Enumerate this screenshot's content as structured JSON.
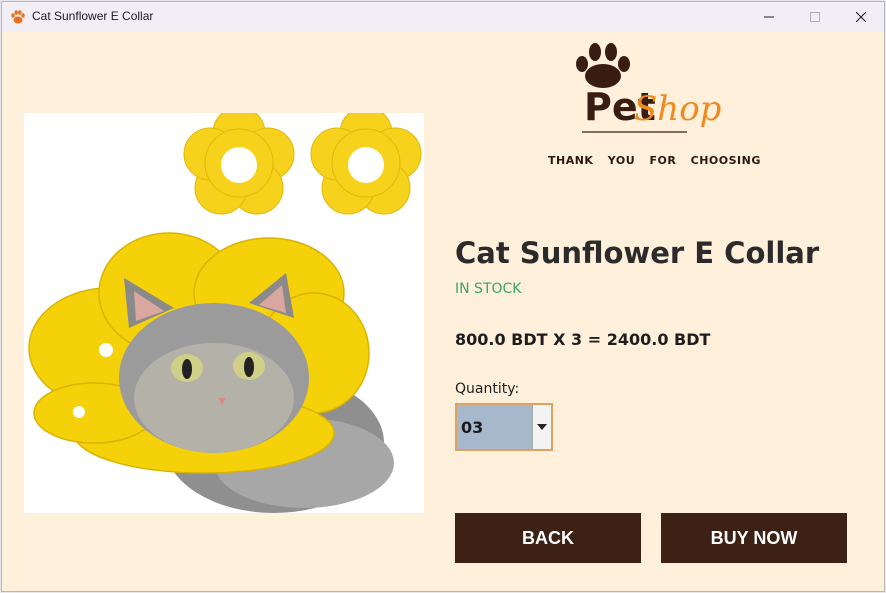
{
  "window": {
    "title": "Cat Sunflower E Collar",
    "icon": "paw-icon",
    "controls": [
      "minimize-icon",
      "maximize-icon",
      "close-icon"
    ]
  },
  "logo": {
    "part1": "Pet",
    "part2": "Shop",
    "tagline": "THANK YOU FOR CHOOSING"
  },
  "product": {
    "name": "Cat Sunflower E Collar",
    "stock_status": "IN STOCK",
    "price_line": "800.0 BDT  X 3 = 2400.0 BDT",
    "image": "photo of grey cat wearing yellow sunflower e-collar"
  },
  "quantity": {
    "label": "Quantity:",
    "selected": "03"
  },
  "buttons": {
    "back": "BACK",
    "buy": "BUY NOW"
  },
  "colors": {
    "background": "#fff0dc",
    "button": "#3e2115",
    "in_stock": "#3aa36b",
    "accent_orange": "#f08a1c",
    "select_bg": "#a5b8cc"
  }
}
